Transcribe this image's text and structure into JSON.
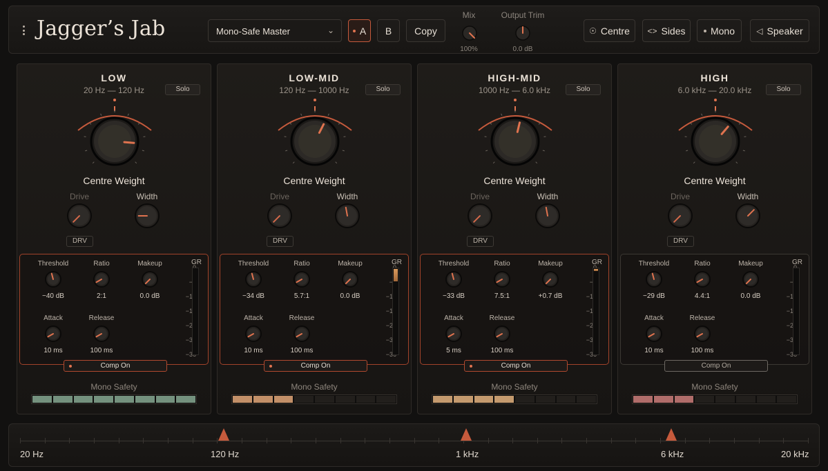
{
  "header": {
    "title": "Jagger’s Jab",
    "preset": "Mono-Safe Master",
    "ab_a": "A",
    "ab_b": "B",
    "copy": "Copy",
    "mix_label": "Mix",
    "mix_value": "100%",
    "trim_label": "Output Trim",
    "trim_value": "0.0 dB",
    "monitor_centre": "Centre",
    "monitor_sides": "Sides",
    "monitor_mono": "Mono",
    "monitor_speaker": "Speaker"
  },
  "labels": {
    "solo": "Solo",
    "centre_weight": "Centre Weight",
    "drive": "Drive",
    "width": "Width",
    "drv": "DRV",
    "threshold": "Threshold",
    "ratio": "Ratio",
    "makeup": "Makeup",
    "attack": "Attack",
    "release": "Release",
    "gr": "GR",
    "comp_on": "Comp On",
    "mono_safety": "Mono Safety"
  },
  "gr_scale": [
    "0",
    "−6",
    "−12",
    "−18",
    "−24",
    "−30",
    "−36"
  ],
  "bands": [
    {
      "name": "LOW",
      "range": "20 Hz — 120 Hz",
      "threshold": "−40 dB",
      "ratio": "2:1",
      "makeup": "0.0 dB",
      "attack": "10 ms",
      "release": "100 ms",
      "comp_active": true,
      "gr_level": 0.0,
      "mono_safety_segments": 8,
      "mono_safety_color": "#74917e",
      "centre_weight_level": 0.85
    },
    {
      "name": "LOW-MID",
      "range": "120 Hz — 1000 Hz",
      "threshold": "−34 dB",
      "ratio": "5.7:1",
      "makeup": "0.0 dB",
      "attack": "10 ms",
      "release": "100 ms",
      "comp_active": true,
      "gr_level": 0.14,
      "mono_safety_segments": 3,
      "mono_safety_color": "#c28f68",
      "centre_weight_level": 0.6
    },
    {
      "name": "HIGH-MID",
      "range": "1000 Hz — 6.0 kHz",
      "threshold": "−33 dB",
      "ratio": "7.5:1",
      "makeup": "+0.7 dB",
      "attack": "5 ms",
      "release": "100 ms",
      "comp_active": true,
      "gr_level": 0.02,
      "mono_safety_segments": 4,
      "mono_safety_color": "#c49a6e",
      "centre_weight_level": 0.55
    },
    {
      "name": "HIGH",
      "range": "6.0 kHz — 20.0 kHz",
      "threshold": "−29 dB",
      "ratio": "4.4:1",
      "makeup": "0.0 dB",
      "attack": "10 ms",
      "release": "100 ms",
      "comp_active": false,
      "gr_level": 0.0,
      "mono_safety_segments": 3,
      "mono_safety_color": "#b06d6a",
      "centre_weight_level": 0.65
    }
  ],
  "crossover": {
    "labels": [
      "20 Hz",
      "120 Hz",
      "1 kHz",
      "6 kHz",
      "20 kHz"
    ],
    "accent": "#c65a3c"
  },
  "colors": {
    "accent": "#e0734f",
    "background": "#121110"
  }
}
